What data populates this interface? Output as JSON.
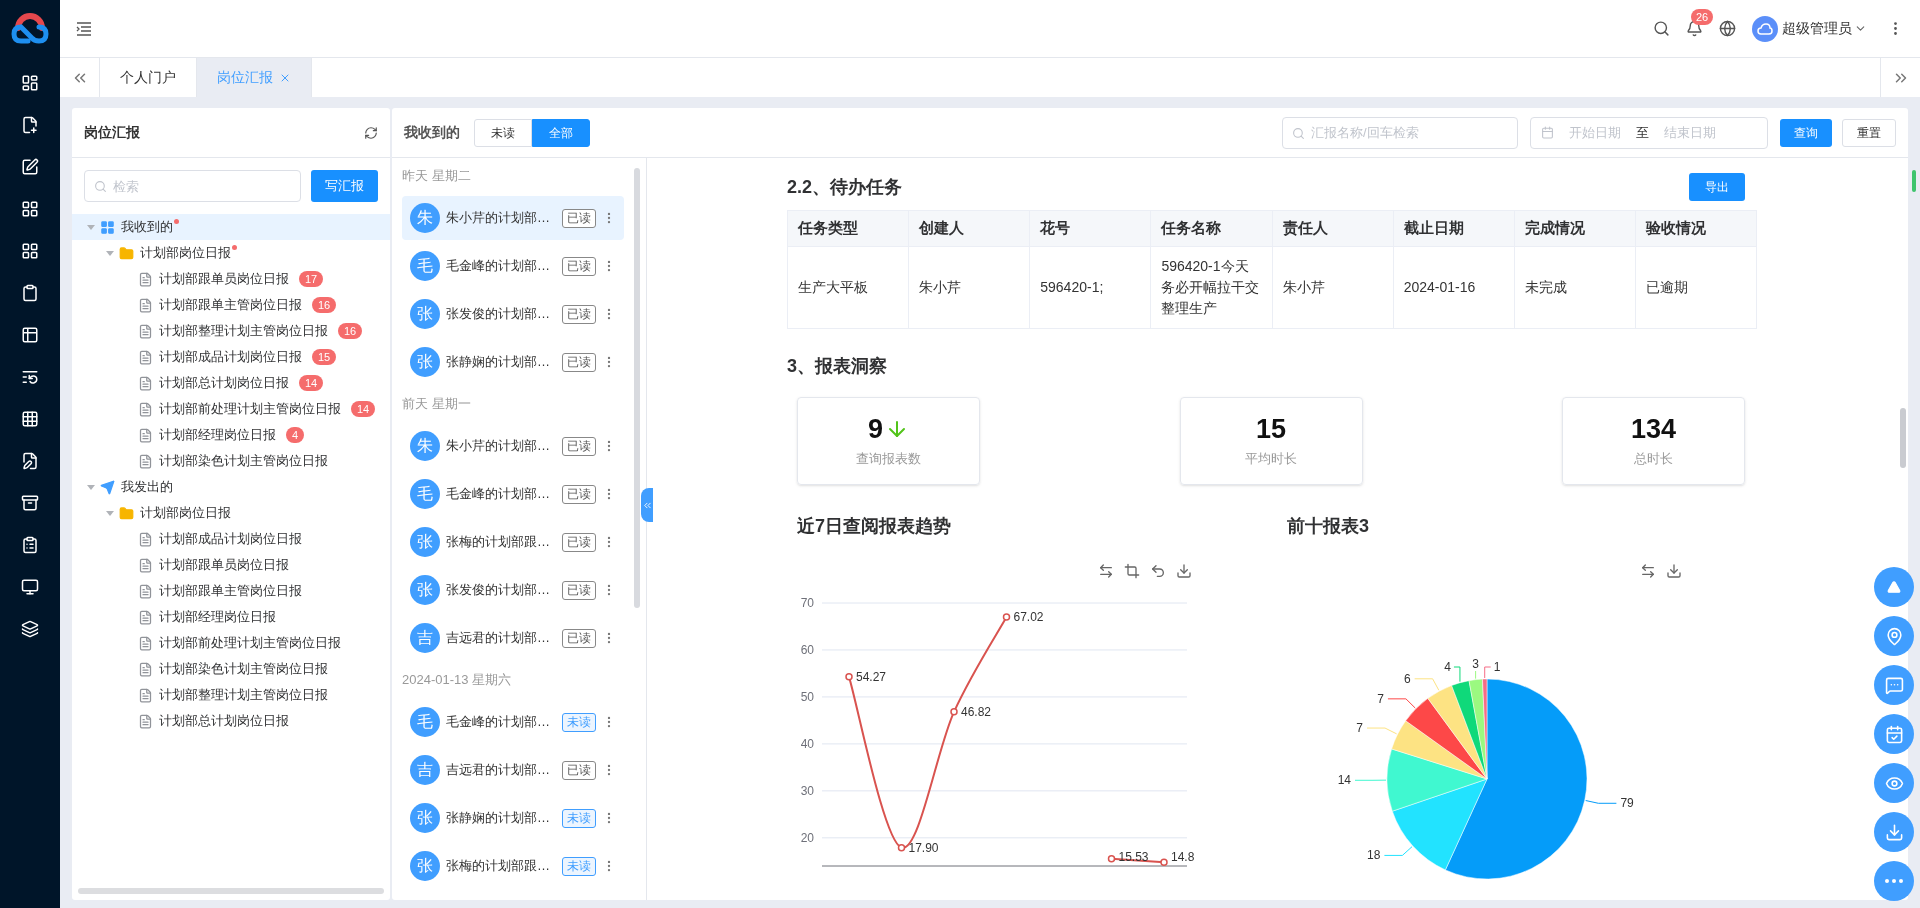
{
  "header": {
    "notification_count": "26",
    "user_name": "超级管理员"
  },
  "tabs": [
    {
      "label": "个人门户",
      "selected": false,
      "closable": false
    },
    {
      "label": "岗位汇报",
      "selected": true,
      "closable": true
    }
  ],
  "tree_panel": {
    "title": "岗位汇报",
    "search_placeholder": "检索",
    "write_button": "写汇报",
    "nodes": [
      {
        "label": "我收到的",
        "kind": "inbox",
        "expanded": true,
        "dot": true,
        "selected": true,
        "children": [
          {
            "label": "计划部岗位日报",
            "kind": "folder",
            "expanded": true,
            "dot": true,
            "selected": false,
            "children": [
              {
                "label": "计划部跟单员岗位日报",
                "kind": "report",
                "count": "17",
                "dot": false,
                "selected": false
              },
              {
                "label": "计划部跟单主管岗位日报",
                "kind": "report",
                "count": "16",
                "dot": false,
                "selected": false
              },
              {
                "label": "计划部整理计划主管岗位日报",
                "kind": "report",
                "count": "16",
                "dot": false,
                "selected": false
              },
              {
                "label": "计划部成品计划岗位日报",
                "kind": "report",
                "count": "15",
                "dot": false,
                "selected": false
              },
              {
                "label": "计划部总计划岗位日报",
                "kind": "report",
                "count": "14",
                "dot": false,
                "selected": false
              },
              {
                "label": "计划部前处理计划主管岗位日报",
                "kind": "report",
                "count": "14",
                "dot": false,
                "selected": false
              },
              {
                "label": "计划部经理岗位日报",
                "kind": "report",
                "count": "4",
                "dot": false,
                "selected": false
              },
              {
                "label": "计划部染色计划主管岗位日报",
                "kind": "report",
                "dot": false,
                "selected": false
              }
            ]
          }
        ]
      },
      {
        "label": "我发出的",
        "kind": "sent",
        "expanded": true,
        "dot": false,
        "selected": false,
        "children": [
          {
            "label": "计划部岗位日报",
            "kind": "folder",
            "expanded": true,
            "dot": false,
            "selected": false,
            "children": [
              {
                "label": "计划部成品计划岗位日报",
                "kind": "report",
                "dot": false,
                "selected": false
              },
              {
                "label": "计划部跟单员岗位日报",
                "kind": "report",
                "dot": false,
                "selected": false
              },
              {
                "label": "计划部跟单主管岗位日报",
                "kind": "report",
                "dot": false,
                "selected": false
              },
              {
                "label": "计划部经理岗位日报",
                "kind": "report",
                "dot": false,
                "selected": false
              },
              {
                "label": "计划部前处理计划主管岗位日报",
                "kind": "report",
                "dot": false,
                "selected": false
              },
              {
                "label": "计划部染色计划主管岗位日报",
                "kind": "report",
                "dot": false,
                "selected": false
              },
              {
                "label": "计划部整理计划主管岗位日报",
                "kind": "report",
                "dot": false,
                "selected": false
              },
              {
                "label": "计划部总计划岗位日报",
                "kind": "report",
                "dot": false,
                "selected": false
              }
            ]
          }
        ]
      }
    ]
  },
  "toolbar": {
    "title": "我收到的",
    "filters": [
      {
        "label": "未读",
        "selected": false
      },
      {
        "label": "全部",
        "selected": true
      }
    ],
    "search_placeholder": "汇报名称/回车检索",
    "start_placeholder": "开始日期",
    "range_separator": "至",
    "end_placeholder": "结束日期",
    "query_button": "查询",
    "reset_button": "重置"
  },
  "message_groups": [
    {
      "date": "昨天 星期二",
      "items": [
        {
          "avatar": "朱",
          "title": "朱小芹的计划部…",
          "status": "已读",
          "unread": false,
          "selected": true
        },
        {
          "avatar": "毛",
          "title": "毛金峰的计划部…",
          "status": "已读",
          "unread": false,
          "selected": false
        },
        {
          "avatar": "张",
          "title": "张发俊的计划部…",
          "status": "已读",
          "unread": false,
          "selected": false
        },
        {
          "avatar": "张",
          "title": "张静娴的计划部…",
          "status": "已读",
          "unread": false,
          "selected": false
        }
      ]
    },
    {
      "date": "前天 星期一",
      "items": [
        {
          "avatar": "朱",
          "title": "朱小芹的计划部…",
          "status": "已读",
          "unread": false,
          "selected": false
        },
        {
          "avatar": "毛",
          "title": "毛金峰的计划部…",
          "status": "已读",
          "unread": false,
          "selected": false
        },
        {
          "avatar": "张",
          "title": "张梅的计划部跟…",
          "status": "已读",
          "unread": false,
          "selected": false
        },
        {
          "avatar": "张",
          "title": "张发俊的计划部…",
          "status": "已读",
          "unread": false,
          "selected": false
        },
        {
          "avatar": "吉",
          "title": "吉远君的计划部…",
          "status": "已读",
          "unread": false,
          "selected": false
        }
      ]
    },
    {
      "date": "2024-01-13 星期六",
      "items": [
        {
          "avatar": "毛",
          "title": "毛金峰的计划部…",
          "status": "未读",
          "unread": true,
          "selected": false
        },
        {
          "avatar": "吉",
          "title": "吉远君的计划部…",
          "status": "已读",
          "unread": false,
          "selected": false
        },
        {
          "avatar": "张",
          "title": "张静娴的计划部…",
          "status": "未读",
          "unread": true,
          "selected": false
        },
        {
          "avatar": "张",
          "title": "张梅的计划部跟…",
          "status": "未读",
          "unread": true,
          "selected": false
        }
      ]
    }
  ],
  "tasks": {
    "title": "2.2、待办任务",
    "export_button": "导出",
    "columns": [
      "任务类型",
      "创建人",
      "花号",
      "任务名称",
      "责任人",
      "截止日期",
      "完成情况",
      "验收情况"
    ],
    "rows": [
      [
        "生产大平板",
        "朱小芹",
        "596420-1;",
        "596420-1今天务必开幅拉干交整理生产",
        "朱小芹",
        "2024-01-16",
        "未完成",
        "已逾期"
      ]
    ]
  },
  "insights": {
    "title": "3、报表洞察",
    "cards": [
      {
        "value": "9",
        "label": "查询报表数",
        "trend_down": true
      },
      {
        "value": "15",
        "label": "平均时长",
        "trend_down": false
      },
      {
        "value": "134",
        "label": "总时长",
        "trend_down": false
      }
    ]
  },
  "trend_chart": {
    "title": "近7日查阅报表趋势",
    "chart_data": {
      "type": "line",
      "grid": true,
      "ylim": [
        14,
        70
      ],
      "yticks": [
        20,
        30,
        40,
        50,
        60,
        70
      ],
      "series": [
        {
          "color": "#d9534f",
          "marker": "circle",
          "values": [
            54.27,
            17.9,
            46.82,
            67.02,
            null,
            15.53,
            14.8
          ]
        }
      ],
      "value_labels": [
        "54.27",
        "17.90",
        "46.82",
        "67.02",
        null,
        "15.53",
        "14.8"
      ]
    }
  },
  "top_chart": {
    "title": "前十报表3",
    "chart_data": {
      "type": "pie",
      "data_labels": true,
      "series": [
        {
          "values": [
            79,
            18,
            14,
            7,
            7,
            6,
            4,
            3,
            1
          ]
        }
      ],
      "colors": [
        "#059cf9",
        "#22e3ff",
        "#40f8d0",
        "#fde383",
        "#fd4848",
        "#fde383",
        "#0fd97a",
        "#9bf980",
        "#f56c86"
      ]
    }
  }
}
